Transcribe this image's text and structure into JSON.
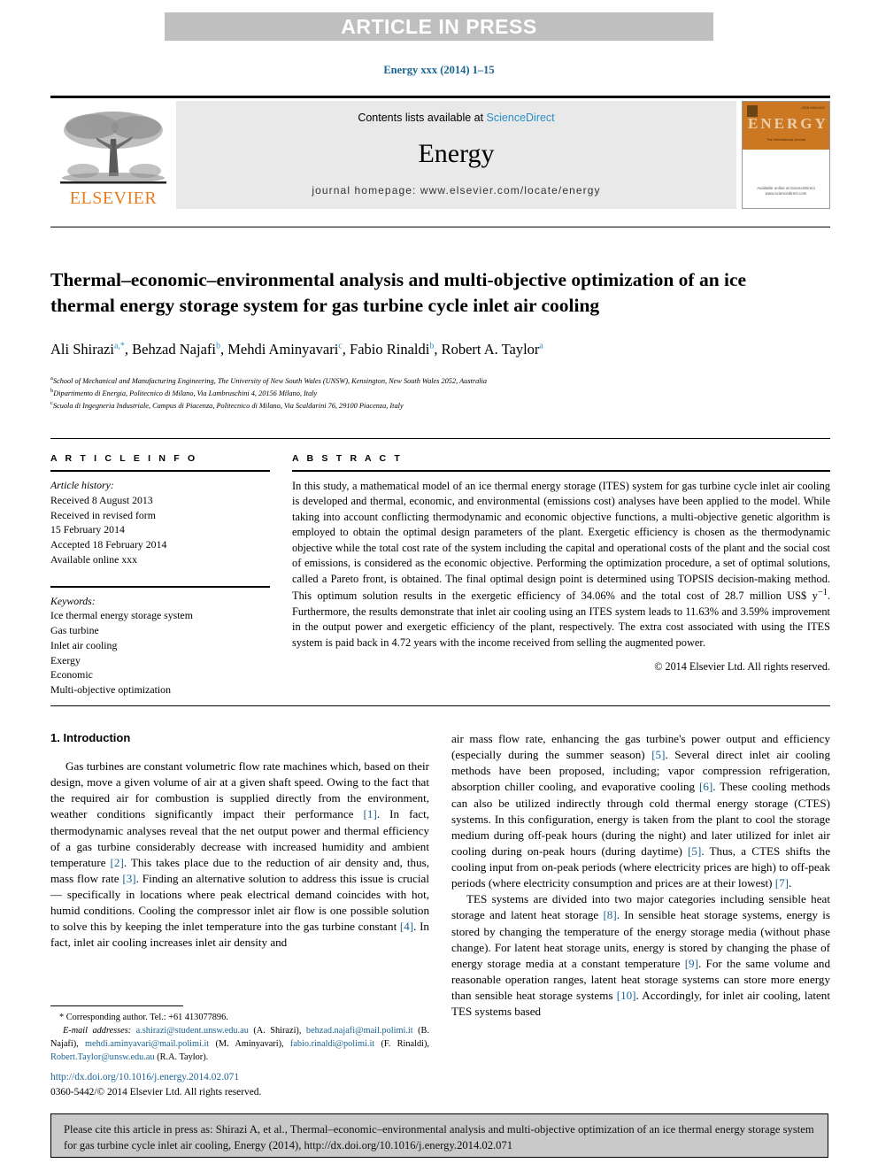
{
  "banner": {
    "text": "ARTICLE IN PRESS"
  },
  "journal_ref": "Energy xxx (2014) 1–15",
  "masthead": {
    "contents_prefix": "Contents lists available at ",
    "sciencedirect": "ScienceDirect",
    "journal_name": "Energy",
    "homepage": "journal homepage: www.elsevier.com/locate/energy",
    "publisher": "ELSEVIER",
    "cover": {
      "title": "ENERGY",
      "subtitle": "The International Journal",
      "corner_note": "ISSN 0360-5442",
      "bottom_note": "Available online at\nScienceDirect\nwww.sciencedirect.com"
    }
  },
  "article": {
    "title": "Thermal–economic–environmental analysis and multi-objective optimization of an ice thermal energy storage system for gas turbine cycle inlet air cooling",
    "authors_html": "Ali Shirazi<sup>a,*</sup>, Behzad Najafi<sup>b</sup>, Mehdi Aminyavari<sup>c</sup>, Fabio Rinaldi<sup>b</sup>, Robert A. Taylor<sup>a</sup>",
    "affiliations": [
      {
        "marker": "a",
        "text": "School of Mechanical and Manufacturing Engineering, The University of New South Wales (UNSW), Kensington, New South Wales 2052, Australia"
      },
      {
        "marker": "b",
        "text": "Dipartimento di Energia, Politecnico di Milano, Via Lambruschini 4, 20156 Milano, Italy"
      },
      {
        "marker": "c",
        "text": "Scuola di Ingegneria Industriale, Campus di Piacenza, Politecnico di Milano, Via Scaldarini 76, 29100 Piacenza, Italy"
      }
    ]
  },
  "article_info": {
    "heading": "A R T I C L E  I N F O",
    "history_label": "Article history:",
    "history": [
      "Received 8 August 2013",
      "Received in revised form",
      "15 February 2014",
      "Accepted 18 February 2014",
      "Available online xxx"
    ],
    "keywords_label": "Keywords:",
    "keywords": [
      "Ice thermal energy storage system",
      "Gas turbine",
      "Inlet air cooling",
      "Exergy",
      "Economic",
      "Multi-objective optimization"
    ]
  },
  "abstract": {
    "heading": "A B S T R A C T",
    "part1": "In this study, a mathematical model of an ice thermal energy storage (ITES) system for gas turbine cycle inlet air cooling is developed and thermal, economic, and environmental (emissions cost) analyses have been applied to the model. While taking into account conflicting thermodynamic and economic objective functions, a multi-objective genetic algorithm is employed to obtain the optimal design parameters of the plant. Exergetic efficiency is chosen as the thermodynamic objective while the total cost rate of the system including the capital and operational costs of the plant and the social cost of emissions, is considered as the economic objective. Performing the optimization procedure, a set of optimal solutions, called a Pareto front, is obtained. The final optimal design point is determined using TOPSIS decision-making method. This optimum solution results in the exergetic efficiency of 34.06% and the total cost of 28.7 million US$ y",
    "superscript": "−1",
    "part2": ". Furthermore, the results demonstrate that inlet air cooling using an ITES system leads to 11.63% and 3.59% improvement in the output power and exergetic efficiency of the plant, respectively. The extra cost associated with using the ITES system is paid back in 4.72 years with the income received from selling the augmented power.",
    "copyright": "© 2014 Elsevier Ltd. All rights reserved."
  },
  "introduction": {
    "heading": "1. Introduction",
    "left_paragraph_html": "Gas turbines are constant volumetric flow rate machines which, based on their design, move a given volume of air at a given shaft speed. Owing to the fact that the required air for combustion is supplied directly from the environment, weather conditions significantly impact their performance <span class=\"ref\">[1]</span>. In fact, thermodynamic analyses reveal that the net output power and thermal efficiency of a gas turbine considerably decrease with increased humidity and ambient temperature <span class=\"ref\">[2]</span>. This takes place due to the reduction of air density and, thus, mass flow rate <span class=\"ref\">[3]</span>. Finding an alternative solution to address this issue is crucial — specifically in locations where peak electrical demand coincides with hot, humid conditions. Cooling the compressor inlet air flow is one possible solution to solve this by keeping the inlet temperature into the gas turbine constant <span class=\"ref\">[4]</span>. In fact, inlet air cooling increases inlet air density and",
    "right_paragraph1_html": "air mass flow rate, enhancing the gas turbine's power output and efficiency (especially during the summer season) <span class=\"ref\">[5]</span>. Several direct inlet air cooling methods have been proposed, including; vapor compression refrigeration, absorption chiller cooling, and evaporative cooling <span class=\"ref\">[6]</span>. These cooling methods can also be utilized indirectly through cold thermal energy storage (CTES) systems. In this configuration, energy is taken from the plant to cool the storage medium during off-peak hours (during the night) and later utilized for inlet air cooling during on-peak hours (during daytime) <span class=\"ref\">[5]</span>. Thus, a CTES shifts the cooling input from on-peak periods (where electricity prices are high) to off-peak periods (where electricity consumption and prices are at their lowest) <span class=\"ref\">[7]</span>.",
    "right_paragraph2_html": "TES systems are divided into two major categories including sensible heat storage and latent heat storage <span class=\"ref\">[8]</span>. In sensible heat storage systems, energy is stored by changing the temperature of the energy storage media (without phase change). For latent heat storage units, energy is stored by changing the phase of energy storage media at a constant temperature <span class=\"ref\">[9]</span>. For the same volume and reasonable operation ranges, latent heat storage systems can store more energy than sensible heat storage systems <span class=\"ref\">[10]</span>. Accordingly, for inlet air cooling, latent TES systems based"
  },
  "footnotes": {
    "corresponding_html": "* Corresponding author. Tel.: +61 413077896.",
    "emails_html": "<span class=\"emlabel\">E-mail addresses:</span> <span class=\"email\">a.shirazi@student.unsw.edu.au</span> (A. Shirazi), <span class=\"email\">behzad.najafi@mail.polimi.it</span> (B. Najafi), <span class=\"email\">mehdi.aminyavari@mail.polimi.it</span> (M. Aminyavari), <span class=\"email\">fabio.rinaldi@polimi.it</span> (F. Rinaldi), <span class=\"email\">Robert.Taylor@unsw.edu.au</span> (R.A. Taylor).",
    "doi": "http://dx.doi.org/10.1016/j.energy.2014.02.071",
    "issn_line": "0360-5442/© 2014 Elsevier Ltd. All rights reserved."
  },
  "cite_box": {
    "text": "Please cite this article in press as: Shirazi A, et al., Thermal–economic–environmental analysis and multi-objective optimization of an ice thermal energy storage system for gas turbine cycle inlet air cooling, Energy (2014), http://dx.doi.org/10.1016/j.energy.2014.02.071"
  },
  "colors": {
    "banner_bg": "#bfbfbf",
    "link_blue": "#1a6496",
    "sciencedirect_blue": "#2b8fc4",
    "elsevier_orange": "#E87D1E",
    "cover_orange": "#cc7722",
    "cite_bg": "#c9c9c9"
  }
}
